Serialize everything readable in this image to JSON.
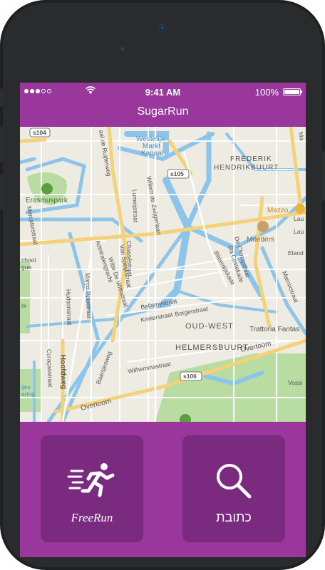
{
  "status_bar": {
    "time": "9:41 AM",
    "battery": "100%"
  },
  "app": {
    "title": "SugarRun"
  },
  "map": {
    "labels": [
      "s104",
      "s105",
      "s106",
      "Westelijk",
      "Markt",
      "Kanaal",
      "FREDERIK",
      "HENDRIKBUURT",
      "Erasmuspark",
      "Mazzo",
      "Moeders",
      "OUD-WEST",
      "HELMERSBUURT",
      "Trattoria Fantas",
      "Overtoom",
      "Overtoom",
      "Bellamystraat",
      "Kinkerstraat",
      "Borgerstraat",
      "Wilheminastraat",
      "Willem de Zwijgerlaan",
      "Admiralengracht",
      "Marco Polostraat",
      "Hudsonstraat",
      "Hoofdweg",
      "Curaçaostraat",
      "Mercatorstraat",
      "Lumeijstraat",
      "Chasséstraat",
      "Van Speijkstraat",
      "Witte De Withstraat",
      "Bilderdijkkade",
      "De Clercqstraat",
      "Da Costakade",
      "Marnixstraat",
      "Baarsjesweg",
      "aal de Ruijterweg",
      "chool",
      "gue",
      "rk",
      "ijes",
      "ering",
      "Lau",
      "Lau",
      "Eland",
      "Vossi",
      "Ma"
    ]
  },
  "actions": {
    "freerun_label": "FreeRun",
    "address_label": "כתובת"
  },
  "colors": {
    "brand_purple": "#99379d",
    "tile_purple": "#7a2a7f",
    "water": "#8cc4ea",
    "road_yellow": "#f3d27a",
    "park_green": "#b9dca2"
  }
}
